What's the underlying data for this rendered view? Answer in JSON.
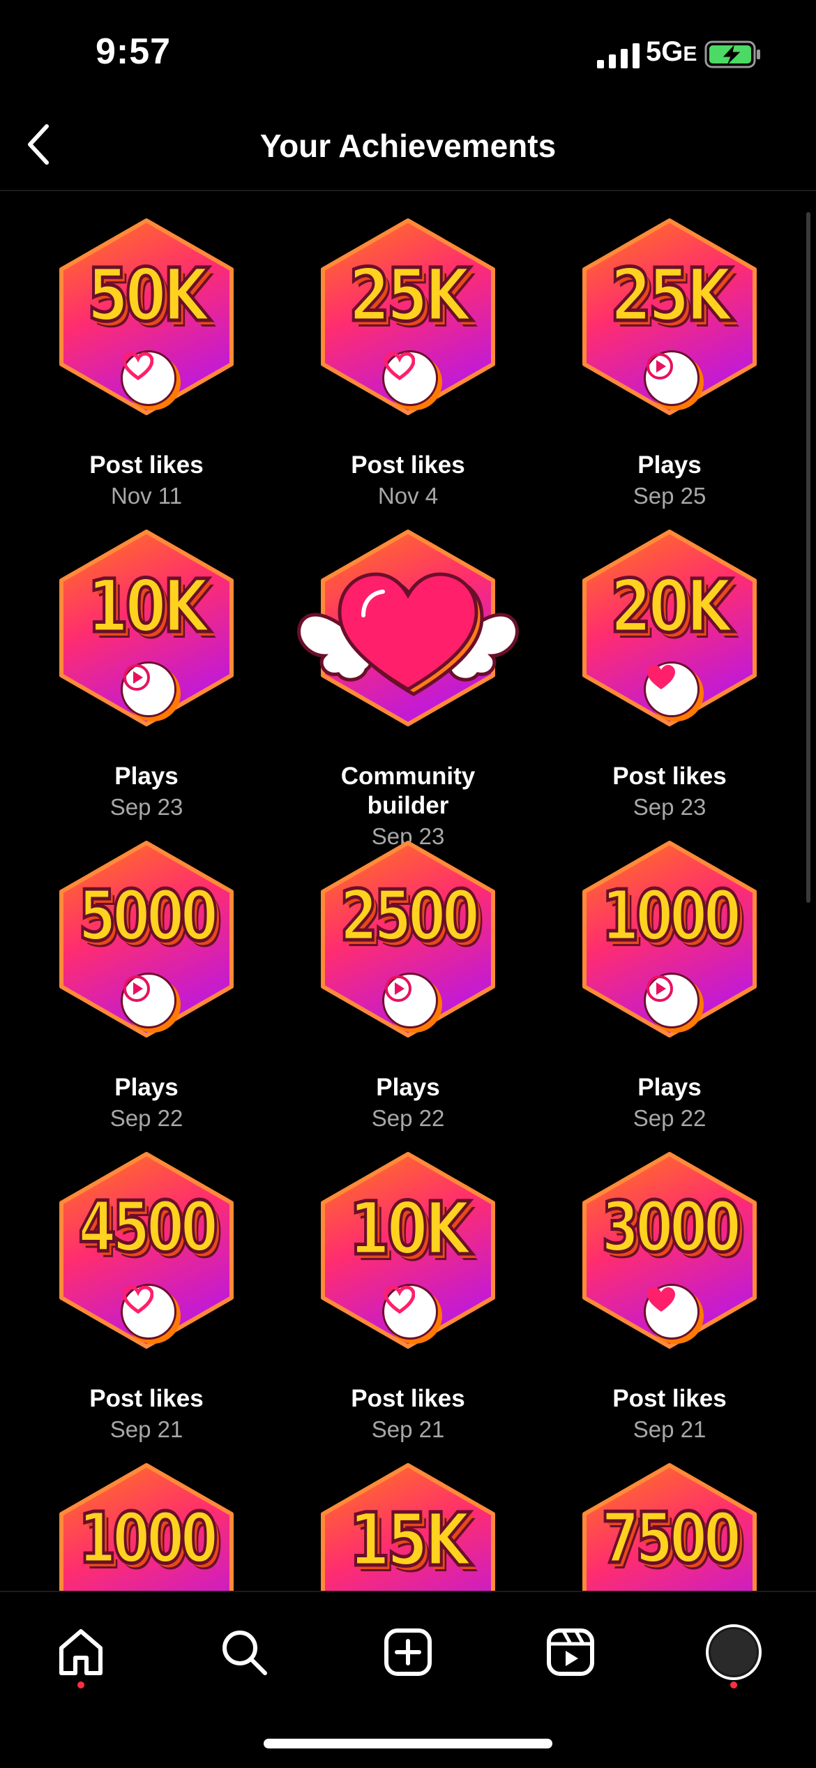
{
  "status": {
    "time": "9:57",
    "network": "5G",
    "network_suffix": "E"
  },
  "header": {
    "title": "Your Achievements"
  },
  "achievements": [
    {
      "badge": "50K",
      "type": "heart",
      "label": "Post likes",
      "date": "Nov 11"
    },
    {
      "badge": "25K",
      "type": "heart",
      "label": "Post likes",
      "date": "Nov 4"
    },
    {
      "badge": "25K",
      "type": "play",
      "label": "Plays",
      "date": "Sep 25"
    },
    {
      "badge": "10K",
      "type": "play",
      "label": "Plays",
      "date": "Sep 23"
    },
    {
      "badge": "",
      "type": "winged-heart",
      "label": "Community builder",
      "date": "Sep 23"
    },
    {
      "badge": "20K",
      "type": "heart",
      "label": "Post likes",
      "date": "Sep 23"
    },
    {
      "badge": "5000",
      "type": "play",
      "label": "Plays",
      "date": "Sep 22"
    },
    {
      "badge": "2500",
      "type": "play",
      "label": "Plays",
      "date": "Sep 22"
    },
    {
      "badge": "1000",
      "type": "play",
      "label": "Plays",
      "date": "Sep 22"
    },
    {
      "badge": "4500",
      "type": "heart",
      "label": "Post likes",
      "date": "Sep 21"
    },
    {
      "badge": "10K",
      "type": "heart",
      "label": "Post likes",
      "date": "Sep 21"
    },
    {
      "badge": "3000",
      "type": "heart",
      "label": "Post likes",
      "date": "Sep 21"
    },
    {
      "badge": "1000",
      "type": "heart",
      "label": "",
      "date": ""
    },
    {
      "badge": "15K",
      "type": "heart",
      "label": "",
      "date": ""
    },
    {
      "badge": "7500",
      "type": "heart",
      "label": "",
      "date": ""
    }
  ],
  "tabs": [
    {
      "name": "home-tab",
      "icon": "home-icon",
      "active": true
    },
    {
      "name": "search-tab",
      "icon": "search-icon",
      "active": false
    },
    {
      "name": "create-tab",
      "icon": "add-square-icon",
      "active": false
    },
    {
      "name": "reels-tab",
      "icon": "reels-icon",
      "active": false
    },
    {
      "name": "profile-tab",
      "icon": "avatar-icon",
      "active": true
    }
  ],
  "colors": {
    "badge_top": "#ff7a1a",
    "badge_mid": "#ff2d6f",
    "badge_bottom": "#c21ad6",
    "badge_text": "#ffd21f",
    "notification_dot": "#ff3040",
    "battery": "#4cd964"
  }
}
